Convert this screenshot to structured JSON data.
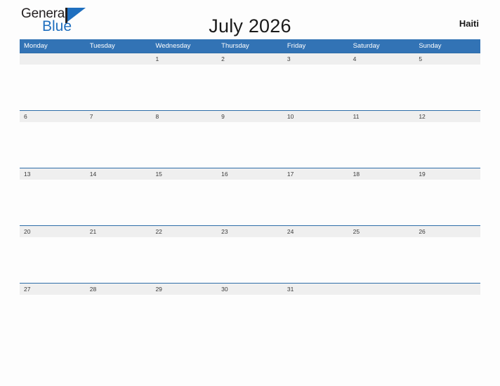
{
  "brand": {
    "name_top": "General",
    "name_bottom": "Blue",
    "mark": "triangle-logo-icon",
    "color_dark": "#231f20",
    "color_blue": "#1f6fbf"
  },
  "header": {
    "title": "July 2026",
    "region": "Haiti"
  },
  "theme": {
    "header_blue": "#3273b5",
    "row_divider_blue": "#2e6da8",
    "date_band_gray": "#efefef",
    "page_background": "#fdfdfd"
  },
  "calendar": {
    "month": "July",
    "year": "2026",
    "week_start": "Monday",
    "weekdays": [
      "Monday",
      "Tuesday",
      "Wednesday",
      "Thursday",
      "Friday",
      "Saturday",
      "Sunday"
    ],
    "weeks": [
      {
        "days": [
          "",
          "",
          "1",
          "2",
          "3",
          "4",
          "5"
        ]
      },
      {
        "days": [
          "6",
          "7",
          "8",
          "9",
          "10",
          "11",
          "12"
        ]
      },
      {
        "days": [
          "13",
          "14",
          "15",
          "16",
          "17",
          "18",
          "19"
        ]
      },
      {
        "days": [
          "20",
          "21",
          "22",
          "23",
          "24",
          "25",
          "26"
        ]
      },
      {
        "days": [
          "27",
          "28",
          "29",
          "30",
          "31",
          "",
          ""
        ]
      }
    ]
  }
}
